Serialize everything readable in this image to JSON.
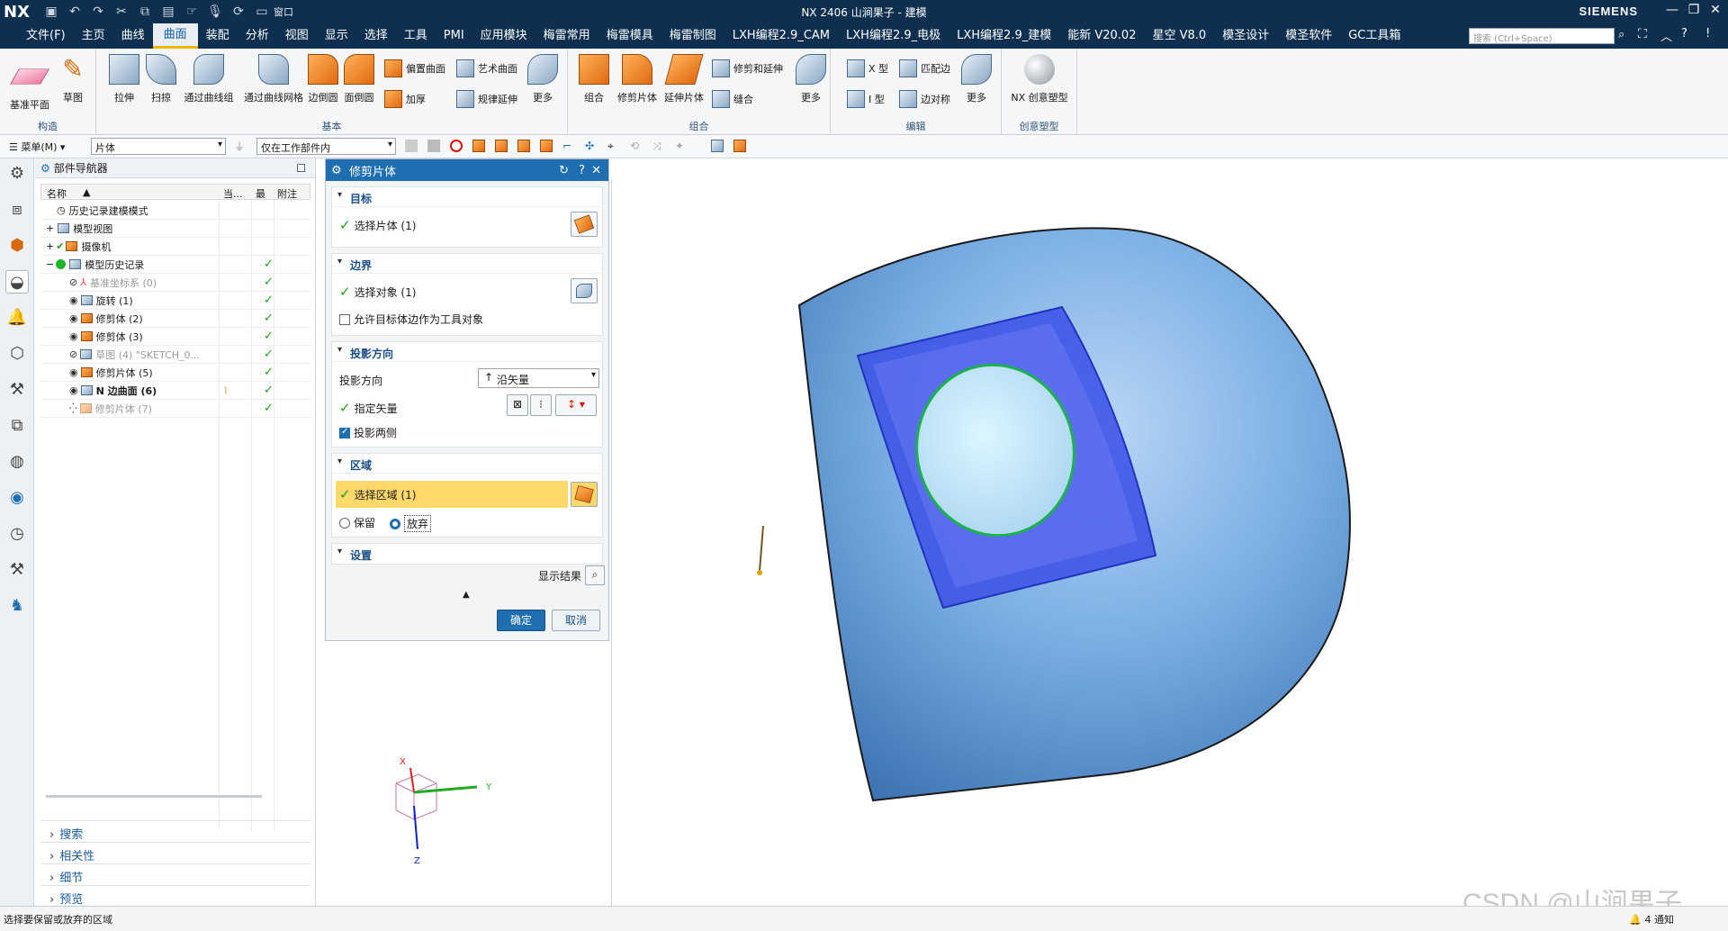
{
  "titlebar": {
    "logo": "NX",
    "title": "NX 2406 山涧果子 - 建模",
    "window_menu": "窗口",
    "brand": "SIEMENS"
  },
  "menu": [
    "文件(F)",
    "主页",
    "曲线",
    "曲面",
    "装配",
    "分析",
    "视图",
    "显示",
    "选择",
    "工具",
    "PMI",
    "应用模块",
    "梅雷常用",
    "梅雷模具",
    "梅雷制图",
    "LXH编程2.9_CAM",
    "LXH编程2.9_电极",
    "LXH编程2.9_建模",
    "能新 V20.02",
    "星空 V8.0",
    "模圣设计",
    "模圣软件",
    "GC工具箱"
  ],
  "active_menu": "曲面",
  "search": {
    "placeholder": "搜索 (Ctrl+Space)"
  },
  "ribbon": {
    "construct": {
      "label": "构造",
      "b1": "基准平面",
      "b2": "草图"
    },
    "basic": {
      "label": "基本",
      "b1": "拉伸",
      "b2": "扫掠",
      "b3": "通过曲线组",
      "b4": "通过曲线网格",
      "b5": "边倒圆",
      "b6": "面倒圆",
      "s1": "偏置曲面",
      "s2": "加厚",
      "s3": "艺术曲面",
      "s4": "规律延伸",
      "more": "更多"
    },
    "combine": {
      "label": "组合",
      "b1": "组合",
      "b2": "修剪片体",
      "b3": "延伸片体",
      "s1": "修剪和延伸",
      "s2": "缝合",
      "more": "更多"
    },
    "edit": {
      "label": "编辑",
      "s1": "X 型",
      "s2": "I 型",
      "s3": "匹配边",
      "s4": "边对称",
      "more": "更多"
    },
    "creative": {
      "label": "创意塑型",
      "b1": "NX 创意塑型"
    }
  },
  "toolbar2": {
    "menu": "菜单(M)",
    "filter": "片体",
    "scope": "仅在工作部件内"
  },
  "navigator": {
    "title": "部件导航器",
    "columns": [
      "名称",
      "当...",
      "最",
      "附注"
    ],
    "rows": [
      {
        "label": "历史记录建模模式"
      },
      {
        "label": "模型视图"
      },
      {
        "label": "摄像机"
      },
      {
        "label": "模型历史记录"
      },
      {
        "label": "基准坐标系 (0)"
      },
      {
        "label": "旋转 (1)"
      },
      {
        "label": "修剪体 (2)"
      },
      {
        "label": "修剪体 (3)"
      },
      {
        "label": "草图 (4) \"SKETCH_0..."
      },
      {
        "label": "修剪片体 (5)"
      },
      {
        "label": "N 边曲面 (6)"
      },
      {
        "label": "修剪片体 (7)"
      }
    ],
    "sections": [
      "搜索",
      "相关性",
      "细节",
      "预览"
    ]
  },
  "dialog": {
    "title": "修剪片体",
    "target": {
      "header": "目标",
      "select": "选择片体 (1)"
    },
    "boundary": {
      "header": "边界",
      "select": "选择对象 (1)",
      "allow": "允许目标体边作为工具对象"
    },
    "projection": {
      "header": "投影方向",
      "label": "投影方向",
      "value": "沿矢量",
      "vector": "指定矢量",
      "both": "投影两侧"
    },
    "region": {
      "header": "区域",
      "select": "选择区域 (1)",
      "keep": "保留",
      "discard": "放弃"
    },
    "settings": {
      "header": "设置"
    },
    "show_result": "显示结果",
    "ok": "确定",
    "cancel": "取消"
  },
  "triad": {
    "x": "X",
    "y": "Y",
    "z": "Z"
  },
  "status": {
    "message": "选择要保留或放弃的区域",
    "notify": "4 通知"
  },
  "watermark": "CSDN @山涧果子",
  "colors": {
    "titlebar": "#0e2f4f",
    "accent": "#1f6fb0",
    "surface": "#6b9fd8",
    "patch": "#3f55e8",
    "circle_edge": "#19b34a",
    "check": "#1aa21a",
    "highlight": "#ffd86b"
  }
}
